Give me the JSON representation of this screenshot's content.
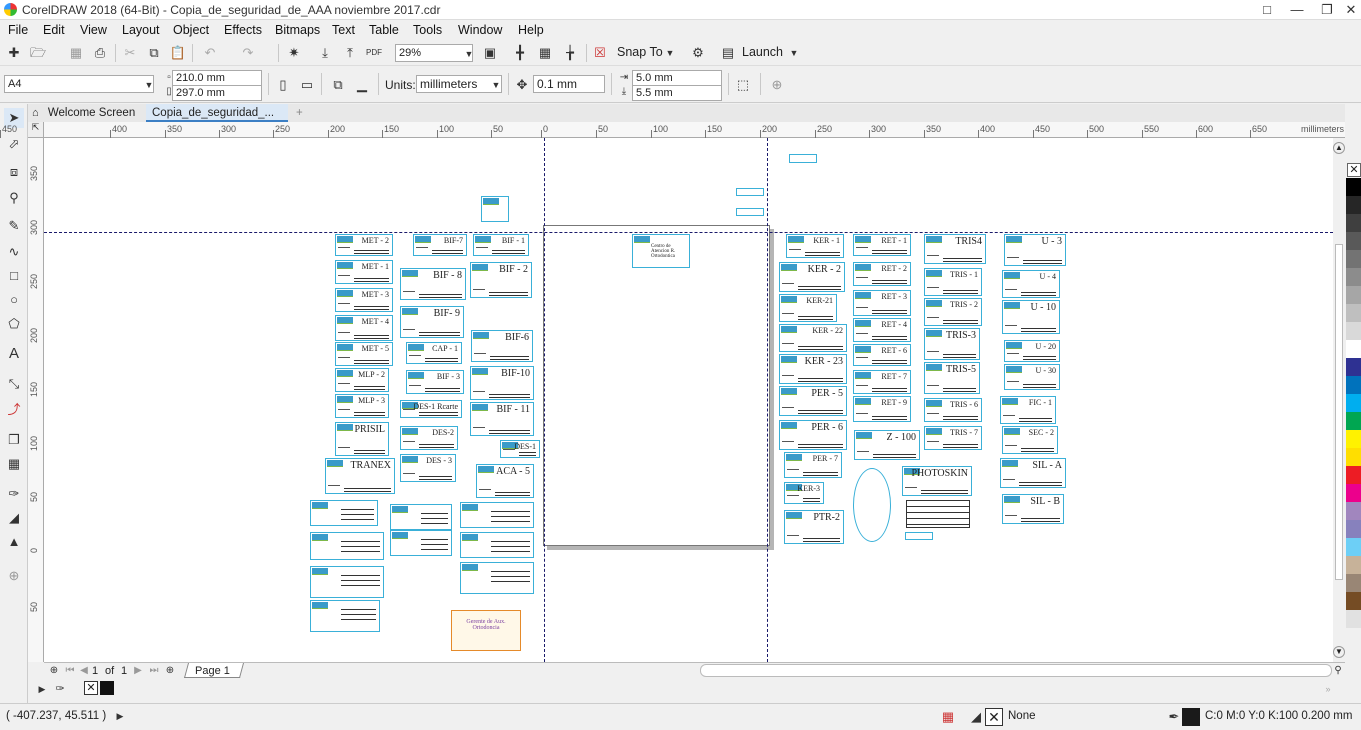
{
  "title": "CorelDRAW 2018 (64-Bit) - Copia_de_seguridad_de_AAA noviembre 2017.cdr",
  "menu": [
    "File",
    "Edit",
    "View",
    "Layout",
    "Object",
    "Effects",
    "Bitmaps",
    "Text",
    "Table",
    "Tools",
    "Window",
    "Help"
  ],
  "toolbar": {
    "zoom": "29%",
    "snap": "Snap To",
    "launch": "Launch"
  },
  "props": {
    "page_size": "A4",
    "width": "210.0 mm",
    "height": "297.0 mm",
    "units_label": "Units:",
    "units": "millimeters",
    "nudge": "0.1 mm",
    "dup_x": "5.0 mm",
    "dup_y": "5.5 mm"
  },
  "tabs": {
    "welcome": "Welcome Screen",
    "doc": "Copia_de_seguridad_..."
  },
  "hruler": {
    "labels": [
      "450",
      "400",
      "350",
      "300",
      "250",
      "200",
      "150",
      "100",
      "50",
      "0",
      "50",
      "100",
      "150",
      "200",
      "250",
      "300",
      "350",
      "400",
      "450",
      "500",
      "550",
      "600",
      "650"
    ],
    "unit": "millimeters"
  },
  "vruler": {
    "labels": [
      "350",
      "300",
      "250",
      "200",
      "150",
      "100",
      "50",
      "0",
      "50"
    ]
  },
  "cards": [
    "MET - 2",
    "BIF-7",
    "BIF - 1",
    "MET - 1",
    "BIF - 8",
    "BIF - 2",
    "MET - 3",
    "BIF- 9",
    "MET - 4",
    "CAP - 1",
    "BIF-6",
    "MET - 5",
    "BIF - 3",
    "BIF-10",
    "MLP - 2",
    "DES-1 Rcarte",
    "BIF - 11",
    "MLP - 3",
    "DES-2",
    "DES-1",
    "PRISIL",
    "DES - 3",
    "ACA - 5",
    "TRANEX",
    "KER - 1",
    "RET - 1",
    "TRIS4",
    "U - 3",
    "KER - 2",
    "RET - 2",
    "TRIS - 1",
    "U - 4",
    "KER-21",
    "RET - 3",
    "TRIS - 2",
    "U - 10",
    "KER - 22",
    "RET - 4",
    "TRIS-3",
    "U - 20",
    "KER - 23",
    "RET - 6",
    "TRIS-5",
    "U - 30",
    "PER - 5",
    "RET - 7",
    "TRIS - 6",
    "FIC - 1",
    "PER - 6",
    "RET - 9",
    "TRIS - 7",
    "SEC - 2",
    "PER - 7",
    "Z - 100",
    "PHOTOSKIN",
    "SIL - A",
    "KER-3",
    "SIL - B",
    "PTR-2"
  ],
  "special": {
    "ortho": "Gerente de Aux. Ortodoncia",
    "page_card": "Centro de Atencion R. Ortodontica"
  },
  "pages": {
    "current": "1",
    "of": "of",
    "total": "1",
    "name": "Page 1"
  },
  "status": {
    "coords": "( -407.237, 45.511 )",
    "fill": "None",
    "outline": "C:0 M:0 Y:0 K:100  0.200 mm"
  },
  "palette": [
    "#000000",
    "#262626",
    "#3f3f3f",
    "#595959",
    "#737373",
    "#8c8c8c",
    "#a6a6a6",
    "#bfbfbf",
    "#d9d9d9",
    "#ffffff",
    "#2e3192",
    "#0072bc",
    "#00aeef",
    "#00a651",
    "#fff200",
    "#ffde00",
    "#ed1c24",
    "#ec008c",
    "#a186be",
    "#8781bd",
    "#6dcff6",
    "#c7b299",
    "#998675",
    "#754c24",
    "#e1e1e1"
  ]
}
